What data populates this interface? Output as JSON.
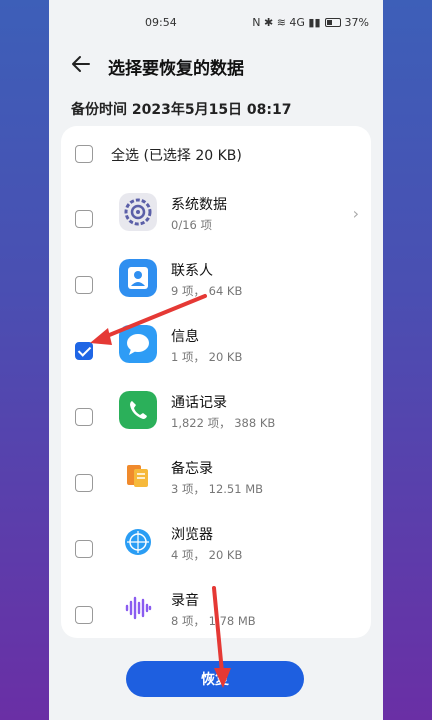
{
  "status_bar": {
    "time": "09:54",
    "icons_text": "N ✱ ≋ 4G ▮▮",
    "battery": "37%"
  },
  "header": {
    "back_icon": "back-arrow-icon",
    "title": "选择要恢复的数据"
  },
  "backup_time": "备份时间 2023年5月15日 08:17",
  "select_all": {
    "label": "全选 (已选择 20 KB)",
    "checked": false
  },
  "items": [
    {
      "name": "系统数据",
      "sub": "0/16 项",
      "icon": "system-data-icon",
      "checked": false,
      "has_chevron": true
    },
    {
      "name": "联系人",
      "sub": "9 项， 64 KB",
      "icon": "contacts-icon",
      "checked": false
    },
    {
      "name": "信息",
      "sub": "1 项， 20 KB",
      "icon": "messages-icon",
      "checked": true
    },
    {
      "name": "通话记录",
      "sub": "1,822 项， 388 KB",
      "icon": "phone-icon",
      "checked": false
    },
    {
      "name": "备忘录",
      "sub": "3 项， 12.51 MB",
      "icon": "notes-icon",
      "checked": false
    },
    {
      "name": "浏览器",
      "sub": "4 项， 20 KB",
      "icon": "browser-icon",
      "checked": false
    },
    {
      "name": "录音",
      "sub": "8 项， 1.78 MB",
      "icon": "recorder-icon",
      "checked": false
    }
  ],
  "restore_button": "恢复",
  "colors": {
    "accent": "#1e5fe0",
    "annotation_arrow": "#e53935"
  }
}
